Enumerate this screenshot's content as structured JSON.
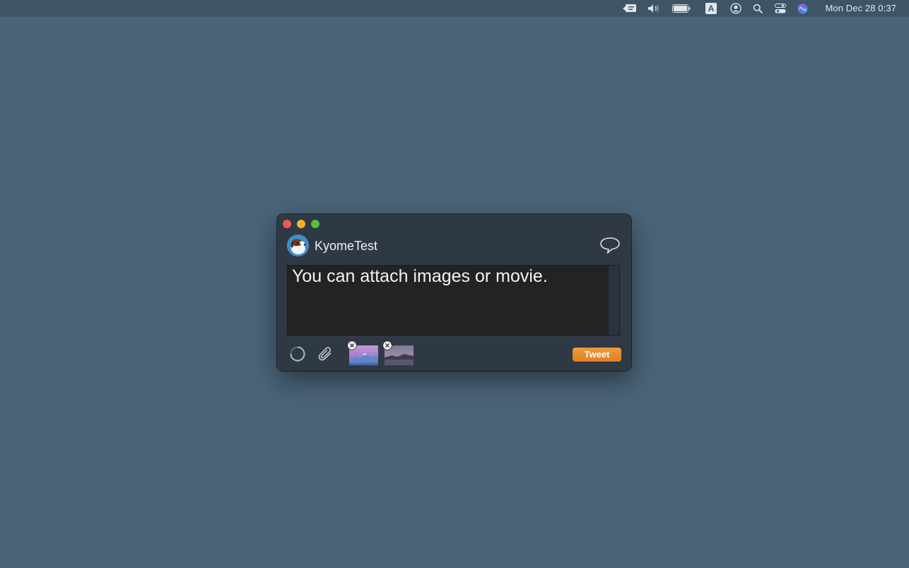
{
  "menubar": {
    "icons": [
      "speech-bubble-icon",
      "volume-icon",
      "battery-icon",
      "input-source-icon",
      "user-icon",
      "spotlight-search-icon",
      "control-center-icon",
      "siri-icon"
    ],
    "input_source_label": "A",
    "clock": "Mon Dec 28  0:37"
  },
  "window": {
    "account_name": "KyomeTest",
    "text_content": "You can attach images or movie.",
    "tweet_label": "Tweet",
    "attachments": [
      "mountain-image-thumbnail",
      "coast-image-thumbnail"
    ]
  },
  "colors": {
    "desktop": "#4b6479",
    "window_bg": "#2f3944",
    "editor_bg": "#232323",
    "tweet_button": "#e8892c",
    "close": "#ee5a52",
    "minimize": "#f2b12f",
    "zoom": "#53c23f"
  }
}
